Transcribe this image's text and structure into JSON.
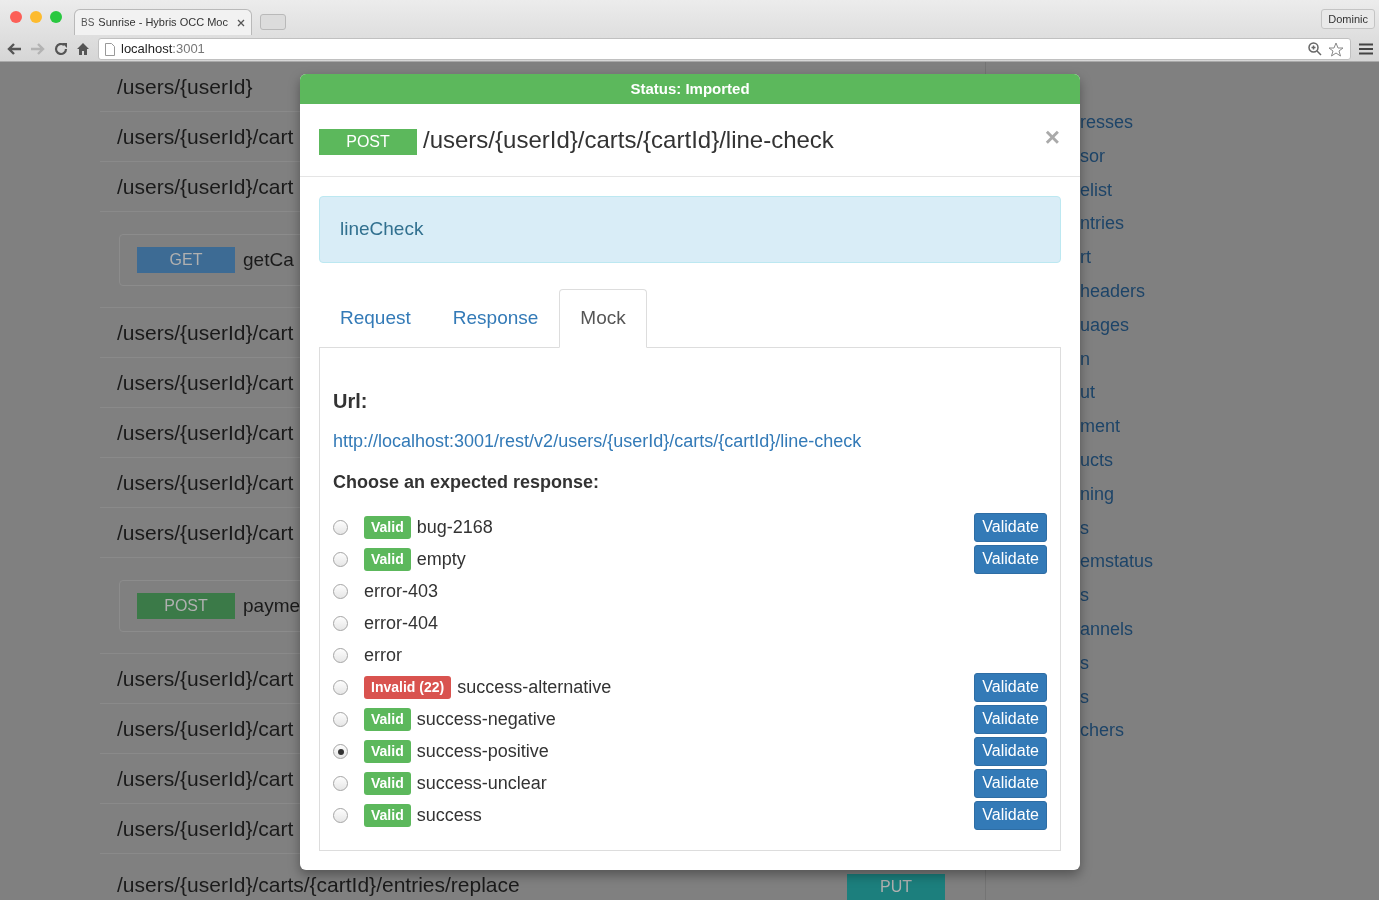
{
  "browser": {
    "favicon": "BS",
    "tab_title": "Sunrise - Hybris OCC Moc",
    "address_host": "localhost",
    "address_port": ":3001",
    "profile": "Dominic"
  },
  "background": {
    "routes": [
      {
        "kind": "path",
        "text": "/users/{userId}"
      },
      {
        "kind": "path",
        "text": "/users/{userId}/cart"
      },
      {
        "kind": "path",
        "text": "/users/{userId}/cart"
      },
      {
        "kind": "operation",
        "method": "GET",
        "color": "#3d6b94",
        "label": "getCa"
      },
      {
        "kind": "path",
        "text": "/users/{userId}/cart"
      },
      {
        "kind": "path",
        "text": "/users/{userId}/cart"
      },
      {
        "kind": "path",
        "text": "/users/{userId}/cart"
      },
      {
        "kind": "path",
        "text": "/users/{userId}/cart"
      },
      {
        "kind": "path",
        "text": "/users/{userId}/cart"
      },
      {
        "kind": "operation",
        "method": "POST",
        "color": "#3b7a48",
        "label": "payme"
      },
      {
        "kind": "path",
        "text": "/users/{userId}/cart"
      },
      {
        "kind": "path",
        "text": "/users/{userId}/cart"
      },
      {
        "kind": "path",
        "text": "/users/{userId}/cart"
      },
      {
        "kind": "path",
        "text": "/users/{userId}/cart"
      },
      {
        "kind": "path_method",
        "text": "/users/{userId}/carts/{cartId}/entries/replace",
        "method": "PUT",
        "color": "#1c7f7d"
      }
    ],
    "sidebar_links": [
      "resses",
      "sor",
      "elist",
      "ntries",
      "rt",
      "headers",
      "uages",
      "n",
      "ut",
      "ment",
      "ucts",
      "ning",
      "s",
      "emstatus",
      "s",
      "annels",
      "s",
      "s",
      "chers"
    ]
  },
  "modal": {
    "status": "Status: Imported",
    "method": "POST",
    "title": "/users/{userId}/carts/{cartId}/line-check",
    "close": "×",
    "info": "lineCheck",
    "tabs": [
      {
        "label": "Request",
        "selected": false
      },
      {
        "label": "Response",
        "selected": false
      },
      {
        "label": "Mock",
        "selected": true
      }
    ],
    "url_label": "Url:",
    "url": "http://localhost:3001/rest/v2/users/{userId}/carts/{cartId}/line-check",
    "prompt": "Choose an expected response:",
    "responses": [
      {
        "name": "bug-2168",
        "selected": false,
        "validation": {
          "kind": "valid",
          "label": "Valid"
        },
        "button": "Validate"
      },
      {
        "name": "empty",
        "selected": false,
        "validation": {
          "kind": "valid",
          "label": "Valid"
        },
        "button": "Validate"
      },
      {
        "name": "error-403",
        "selected": false
      },
      {
        "name": "error-404",
        "selected": false
      },
      {
        "name": "error",
        "selected": false
      },
      {
        "name": "success-alternative",
        "selected": false,
        "validation": {
          "kind": "invalid",
          "label": "Invalid (22)"
        },
        "button": "Validate"
      },
      {
        "name": "success-negative",
        "selected": false,
        "validation": {
          "kind": "valid",
          "label": "Valid"
        },
        "button": "Validate"
      },
      {
        "name": "success-positive",
        "selected": true,
        "validation": {
          "kind": "valid",
          "label": "Valid"
        },
        "button": "Validate"
      },
      {
        "name": "success-unclear",
        "selected": false,
        "validation": {
          "kind": "valid",
          "label": "Valid"
        },
        "button": "Validate"
      },
      {
        "name": "success",
        "selected": false,
        "validation": {
          "kind": "valid",
          "label": "Valid"
        },
        "button": "Validate"
      }
    ]
  }
}
